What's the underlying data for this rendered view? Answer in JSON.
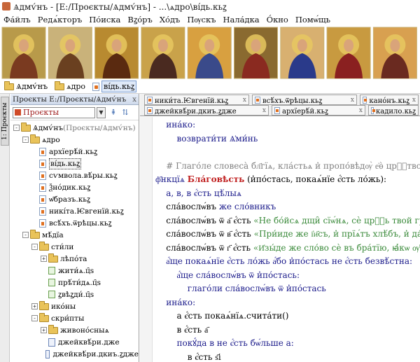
{
  "window": {
    "title": "Ѧдмѵ́нъ - [Е:/Проєкты/Ѧдмѵ́нъ] - ...\\ѧдро\\ві́дь.кьꙁ"
  },
  "menu": [
    "Фа́йлъ",
    "Редѧ́кторъ",
    "По́иска",
    "Вꙁо́ръ",
    "Хо́дъ",
    "Пѹскъ",
    "Нала́дка",
    "О́кно",
    "Помѡ́щь"
  ],
  "breadcrumb": {
    "items": [
      "Ѧдмѵ́нъ",
      "ѧдро",
      "ві́дь.кьꙁ"
    ]
  },
  "side_strip": {
    "tab_label": "1: Проєкты"
  },
  "project_panel": {
    "header": "Проєкты  Е:/Проєкты/Ѧдмѵ́нъ",
    "close_glyph": "x",
    "selector_value": "Проєкты",
    "tree": [
      {
        "label": "Ѧдмѵ́нъ",
        "suffix": "(Проєкты/Ѧдмѵ́нъ)",
        "level": 0,
        "kind": "folder",
        "toggle": "-"
      },
      {
        "label": "ѧдро",
        "level": 1,
        "kind": "folder",
        "toggle": "-"
      },
      {
        "label": "архїерѣ́й.кьꙁ",
        "level": 2,
        "kind": "file"
      },
      {
        "label": "ві́дь.кьꙁ",
        "level": 2,
        "kind": "file",
        "selected": true
      },
      {
        "label": "сѵмвола.вѣ́ры.кьꙁ",
        "level": 2,
        "kind": "file"
      },
      {
        "label": "Ѯно́дик.кьꙁ",
        "level": 2,
        "kind": "file"
      },
      {
        "label": "ѡ̑бразъ.кьꙁ",
        "level": 2,
        "kind": "file"
      },
      {
        "label": "никі́та.Ѥвгенїй.кьꙁ",
        "level": 2,
        "kind": "file"
      },
      {
        "label": "всѣ́хъ.ѿрѣцы.кьꙁ",
        "level": 2,
        "kind": "file"
      },
      {
        "label": "мѣ́дїа",
        "level": 1,
        "kind": "folder",
        "toggle": "-"
      },
      {
        "label": "сти́ли",
        "level": 2,
        "kind": "folder",
        "toggle": "-"
      },
      {
        "label": "лѣпо́та",
        "level": 3,
        "kind": "folder",
        "toggle": "+"
      },
      {
        "label": "жити́ѧ.ц̑ѕ",
        "level": 3,
        "kind": "green"
      },
      {
        "label": "прѣ́ти́дѧ.ц̑ѕ",
        "level": 3,
        "kind": "green"
      },
      {
        "label": "ꙁвѣꙁди́.ц̑ѕ",
        "level": 3,
        "kind": "green"
      },
      {
        "label": "ико́ны",
        "level": 2,
        "kind": "folder",
        "toggle": "+"
      },
      {
        "label": "скри́пты",
        "level": 2,
        "kind": "folder",
        "toggle": "-"
      },
      {
        "label": "живоно́сныѧ",
        "level": 3,
        "kind": "folder",
        "toggle": "+"
      },
      {
        "label": "джейквѣ́ри.дже",
        "level": 3,
        "kind": "doc"
      },
      {
        "label": "джейквѣ́ри.дкиъ.ꙁдже",
        "level": 3,
        "kind": "doc"
      }
    ]
  },
  "tabs": {
    "row1": [
      "ники́та.Ѥвгенїй.кьꙁ",
      "всѣ́хъ.ѿрѣцы.кьꙁ",
      "кано́нъ.кьꙁ"
    ],
    "row2": [
      "джейквѣ́ри.дкиъ.ꙁдже",
      "архїерѣ́й.кьꙁ",
      "кадило.кьꙁ"
    ],
    "close_glyph": "x"
  },
  "code_lines": [
    [
      {
        "t": "    ина́ко:",
        "c": "kw-navy"
      }
    ],
    [
      {
        "t": "        возврати́ти Ѧ̓ми́нь",
        "c": "kw-navy"
      }
    ],
    [
      {
        "t": " ",
        "c": ""
      }
    ],
    [
      {
        "t": "    # Глаго́ле словеса̀ бл҃гїѧ, кла́стьѧ и̓ пропо́вѣдѹ̀ е҆ѳ̀ црⷭ҇тво бж҃їе.",
        "c": "comment"
      }
    ],
    [
      {
        "t": "ф҃нкцїѧ ",
        "c": "kw-navy"
      },
      {
        "t": "Бла́говѣсть",
        "c": "red"
      },
      {
        "t": " (и̓по́стась, покаѧ́нїе є҆́сть ло́жь):",
        "c": ""
      }
    ],
    [
      {
        "t": "    а, в, в є҆́сть цѣ́лыѧ",
        "c": "kw-navy"
      }
    ],
    [
      {
        "t": "    сла́вослѡ́въ ",
        "c": ""
      },
      {
        "t": "же сло́вникъ",
        "c": "kw-navy"
      }
    ],
    [
      {
        "t": "    сла́вослѡ́въ ѿ а҃ є҆́сть ",
        "c": ""
      },
      {
        "t": "«Не бо́йсѧ дщи̑ сїѡ́нѧ, сѐ црⷭ҇ь твой грѧде́тъ,",
        "c": "str"
      }
    ],
    [
      {
        "t": "    сла́вослѡ́въ ѿ в҃ є҆́сть ",
        "c": ""
      },
      {
        "t": "«При́иде же і҆и҃съ, и̓ прїѧ́тъ хлѣ́бъ, и̓ да́де и̓̀мъ",
        "c": "str"
      }
    ],
    [
      {
        "t": "    сла́вослѡ́въ ѿ г҃ є҆́сть ",
        "c": ""
      },
      {
        "t": "«И҆зы́де же сло́во сѐ въ бра́тїю, ꙗ҆́кѡ ѹ҆чени́къ",
        "c": "str"
      }
    ],
    [
      {
        "t": "    а҆́ще покаѧ́нїе є҆́сть ло́жь а҆́бо и̓по́стась не є҆́сть безвѣ́стна:",
        "c": "kw-navy"
      }
    ],
    [
      {
        "t": "        а҆́ще сла́вослѡ́въ ѿ и̓по́стась:",
        "c": "kw-navy"
      }
    ],
    [
      {
        "t": "            глаго́ли сла́вослѡ́въ ѿ и̓по́стась",
        "c": "kw-navy"
      }
    ],
    [
      {
        "t": "    ина́ко:",
        "c": "kw-navy"
      }
    ],
    [
      {
        "t": "        а є҆́сть покаѧ́нїѧ.счита́ти()",
        "c": ""
      }
    ],
    [
      {
        "t": "        в є҆́сть а҃",
        "c": ""
      }
    ],
    [
      {
        "t": "        покꙋ́да в не є҆́сть бѡ́льше а:",
        "c": "kw-navy"
      }
    ],
    [
      {
        "t": "            в є҆́сть ѕ҃і",
        "c": ""
      }
    ]
  ],
  "colors": {
    "icon_frame": "#c8b070",
    "selection": "#dfe9f8",
    "code_string": "#3a8a3a",
    "code_keyword": "#1a1a8a",
    "code_comment": "#808080",
    "function_name": "#c02020"
  },
  "icons_row": [
    {
      "name": "holy-trinity-icon",
      "bg": "#b89a4a",
      "figure": "#7a3a20"
    },
    {
      "name": "mandylion-icon",
      "bg": "#c9b27a",
      "figure": "#6a4020"
    },
    {
      "name": "christ-pantocrator-icon",
      "bg": "#b88a30",
      "figure": "#5a2a10"
    },
    {
      "name": "theotokos-icon",
      "bg": "#c9a24a",
      "figure": "#4a2a20"
    },
    {
      "name": "madonna-icon",
      "bg": "#d8a040",
      "figure": "#3a4a8a"
    },
    {
      "name": "christ-teacher-icon",
      "bg": "#8a6a30",
      "figure": "#8a2a20"
    },
    {
      "name": "madonna-child-icon",
      "bg": "#d8b070",
      "figure": "#2a3a8a"
    },
    {
      "name": "christ-blessing-icon",
      "bg": "#c89a40",
      "figure": "#8a2020"
    },
    {
      "name": "virgin-tenderness-icon",
      "bg": "#d8a050",
      "figure": "#6a2a20"
    }
  ]
}
